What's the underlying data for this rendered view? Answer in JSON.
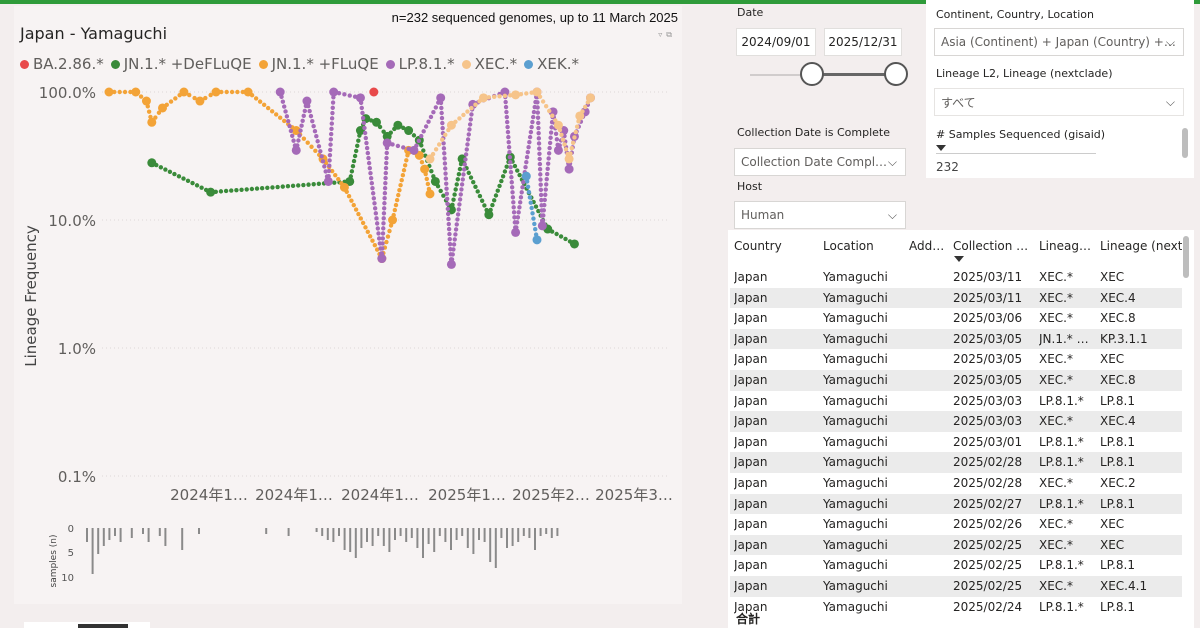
{
  "chart": {
    "title": "Japan - Yamaguchi",
    "subtitle": "n=232 sequenced genomes, up to 11 March 2025",
    "legend": [
      {
        "label": "BA.2.86.*",
        "color": "#e8494a"
      },
      {
        "label": "JN.1.* +DeFLuQE",
        "color": "#3a8b3a"
      },
      {
        "label": "JN.1.* +FLuQE",
        "color": "#f3a337"
      },
      {
        "label": "LP.8.1.*",
        "color": "#a56ab8"
      },
      {
        "label": "XEC.*",
        "color": "#f6c48a"
      },
      {
        "label": "XEK.*",
        "color": "#5b9fd0"
      }
    ],
    "ylabel": "Lineage Frequency",
    "y_ticks": [
      "100.0%",
      "10.0%",
      "1.0%",
      "0.1%"
    ],
    "x_ticks": [
      "2024年1…",
      "2024年1…",
      "2024年1…",
      "2025年1…",
      "2025年2…",
      "2025年3…"
    ],
    "samples_label": "samples (n)",
    "samples_ticks": [
      "0",
      "5",
      "10"
    ]
  },
  "chart_data": {
    "type": "line",
    "title": "Japan - Yamaguchi",
    "subtitle": "n=232 sequenced genomes, up to 11 March 2025",
    "xlabel": "",
    "ylabel": "Lineage Frequency",
    "y_scale": "log",
    "ylim": [
      0.0006,
      1.3
    ],
    "legend_position": "top",
    "x_tick_labels": [
      "2024年1…",
      "2024年1…",
      "2024年1…",
      "2025年1…",
      "2025年2…",
      "2025年3…"
    ],
    "series": [
      {
        "name": "BA.2.86.*",
        "color": "#e8494a",
        "points": [
          [
            0.495,
            1.0
          ]
        ]
      },
      {
        "name": "JN.1.* +DeFLuQE",
        "color": "#3a8b3a",
        "points": [
          [
            0.08,
            0.28
          ],
          [
            0.19,
            0.165
          ],
          [
            0.45,
            0.2
          ],
          [
            0.47,
            0.5
          ],
          [
            0.48,
            0.62
          ],
          [
            0.5,
            0.58
          ],
          [
            0.52,
            0.45
          ],
          [
            0.54,
            0.55
          ],
          [
            0.56,
            0.5
          ],
          [
            0.58,
            0.42
          ],
          [
            0.61,
            0.2
          ],
          [
            0.64,
            0.12
          ],
          [
            0.66,
            0.3
          ],
          [
            0.71,
            0.11
          ],
          [
            0.75,
            0.31
          ],
          [
            0.82,
            0.085
          ],
          [
            0.87,
            0.065
          ]
        ]
      },
      {
        "name": "JN.1.* +FLuQE",
        "color": "#f3a337",
        "points": [
          [
            0.0,
            1.0
          ],
          [
            0.05,
            1.0
          ],
          [
            0.07,
            0.85
          ],
          [
            0.08,
            0.58
          ],
          [
            0.1,
            0.75
          ],
          [
            0.14,
            1.0
          ],
          [
            0.17,
            0.85
          ],
          [
            0.2,
            1.0
          ],
          [
            0.26,
            1.0
          ],
          [
            0.35,
            0.5
          ],
          [
            0.4,
            0.3
          ],
          [
            0.44,
            0.18
          ],
          [
            0.51,
            0.05
          ],
          [
            0.53,
            0.1
          ],
          [
            0.56,
            0.35
          ],
          [
            0.58,
            0.32
          ],
          [
            0.59,
            0.25
          ],
          [
            0.6,
            0.16
          ]
        ]
      },
      {
        "name": "LP.8.1.*",
        "color": "#a56ab8",
        "points": [
          [
            0.35,
            0.35
          ],
          [
            0.41,
            0.2
          ],
          [
            0.51,
            0.05
          ],
          [
            0.64,
            0.045
          ],
          [
            0.76,
            0.08
          ],
          [
            0.81,
            0.09
          ],
          [
            0.83,
            0.7
          ],
          [
            0.84,
            0.35
          ],
          [
            0.85,
            0.5
          ],
          [
            0.86,
            0.25
          ],
          [
            0.87,
            0.45
          ],
          [
            0.89,
            0.7
          ],
          [
            0.9,
            0.9
          ],
          [
            0.32,
            1.0
          ],
          [
            0.37,
            0.85
          ],
          [
            0.42,
            1.0
          ],
          [
            0.47,
            0.9
          ],
          [
            0.52,
            0.4
          ],
          [
            0.57,
            0.35
          ],
          [
            0.62,
            0.9
          ],
          [
            0.68,
            0.8
          ],
          [
            0.74,
            1.0
          ],
          [
            0.8,
            1.0
          ]
        ]
      },
      {
        "name": "XEC.*",
        "color": "#f6c48a",
        "points": [
          [
            0.6,
            0.3
          ],
          [
            0.64,
            0.55
          ],
          [
            0.7,
            0.9
          ],
          [
            0.76,
            0.95
          ],
          [
            0.8,
            1.0
          ],
          [
            0.84,
            0.55
          ],
          [
            0.86,
            0.3
          ],
          [
            0.88,
            0.65
          ],
          [
            0.9,
            0.9
          ]
        ]
      },
      {
        "name": "XEK.*",
        "color": "#5b9fd0",
        "points": [
          [
            0.78,
            0.22
          ],
          [
            0.8,
            0.07
          ]
        ]
      }
    ]
  },
  "slicers": {
    "date_label": "Date",
    "date_start": "2024/09/01",
    "date_end": "2025/12/31",
    "collection_label": "Collection Date is Complete",
    "collection_value": "Collection Date Compl…",
    "host_label": "Host",
    "host_value": "Human",
    "ccl_label": "Continent, Country, Location",
    "ccl_value": "Asia (Continent) + Japan (Country) +…",
    "lineage_label": "Lineage L2, Lineage (nextclade)",
    "lineage_value": "すべて",
    "samples_label": "# Samples Sequenced (gisaid)",
    "samples_value": "232"
  },
  "table": {
    "headers": [
      "Country",
      "Location",
      "Add…",
      "Collection …",
      "Lineag…",
      "Lineage (nextc"
    ],
    "rows": [
      [
        "Japan",
        "Yamaguchi",
        "",
        "2025/03/11",
        "XEC.*",
        "XEC"
      ],
      [
        "Japan",
        "Yamaguchi",
        "",
        "2025/03/11",
        "XEC.*",
        "XEC.4"
      ],
      [
        "Japan",
        "Yamaguchi",
        "",
        "2025/03/06",
        "XEC.*",
        "XEC.8"
      ],
      [
        "Japan",
        "Yamaguchi",
        "",
        "2025/03/05",
        "JN.1.* …",
        "KP.3.1.1"
      ],
      [
        "Japan",
        "Yamaguchi",
        "",
        "2025/03/05",
        "XEC.*",
        "XEC"
      ],
      [
        "Japan",
        "Yamaguchi",
        "",
        "2025/03/05",
        "XEC.*",
        "XEC.8"
      ],
      [
        "Japan",
        "Yamaguchi",
        "",
        "2025/03/03",
        "LP.8.1.*",
        "LP.8.1"
      ],
      [
        "Japan",
        "Yamaguchi",
        "",
        "2025/03/03",
        "XEC.*",
        "XEC.4"
      ],
      [
        "Japan",
        "Yamaguchi",
        "",
        "2025/03/01",
        "LP.8.1.*",
        "LP.8.1"
      ],
      [
        "Japan",
        "Yamaguchi",
        "",
        "2025/02/28",
        "LP.8.1.*",
        "LP.8.1"
      ],
      [
        "Japan",
        "Yamaguchi",
        "",
        "2025/02/28",
        "XEC.*",
        "XEC.2"
      ],
      [
        "Japan",
        "Yamaguchi",
        "",
        "2025/02/27",
        "LP.8.1.*",
        "LP.8.1"
      ],
      [
        "Japan",
        "Yamaguchi",
        "",
        "2025/02/26",
        "XEC.*",
        "XEC"
      ],
      [
        "Japan",
        "Yamaguchi",
        "",
        "2025/02/25",
        "XEC.*",
        "XEC"
      ],
      [
        "Japan",
        "Yamaguchi",
        "",
        "2025/02/25",
        "LP.8.1.*",
        "LP.8.1"
      ],
      [
        "Japan",
        "Yamaguchi",
        "",
        "2025/02/25",
        "XEC.*",
        "XEC.4.1"
      ],
      [
        "Japan",
        "Yamaguchi",
        "",
        "2025/02/24",
        "LP.8.1.*",
        "LP.8.1"
      ]
    ],
    "total_label": "合計"
  },
  "colors": {
    "top_bar": "#2f9b3a",
    "accent_green": "#3a8b3a"
  }
}
